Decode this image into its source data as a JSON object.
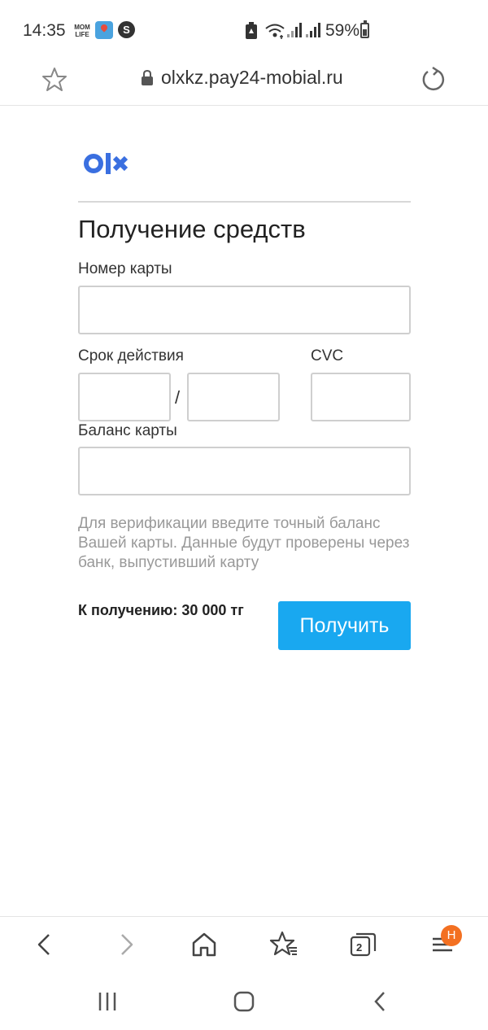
{
  "status_bar": {
    "time": "14:35",
    "notification_app_label": "MOM LIFE",
    "battery_percent": "59%",
    "icons": [
      "momlife-app-icon",
      "maps-app-icon",
      "shazam-app-icon",
      "battery-saver-icon",
      "wifi-icon",
      "signal-icon",
      "signal-icon",
      "battery-icon"
    ]
  },
  "browser": {
    "url": "olxkz.pay24-mobial.ru",
    "tabs_count": "2",
    "menu_badge": "H"
  },
  "page": {
    "title": "Получение средств",
    "card_number_label": "Номер карты",
    "expiry_label": "Срок действия",
    "expiry_separator": "/",
    "cvc_label": "CVC",
    "balance_label": "Баланс карты",
    "card_number_value": "",
    "expiry_month_value": "",
    "expiry_year_value": "",
    "cvc_value": "",
    "balance_value": "",
    "hint": "Для верификации введите точный баланс Вашей карты. Данные будут проверены через банк, выпустивший карту",
    "amount": "К получению: 30 000 тг",
    "submit_label": "Получить"
  },
  "colors": {
    "accent": "#19a8f0",
    "logo_blue": "#3a6fe0",
    "badge": "#f37021",
    "hint_text": "#999999"
  }
}
